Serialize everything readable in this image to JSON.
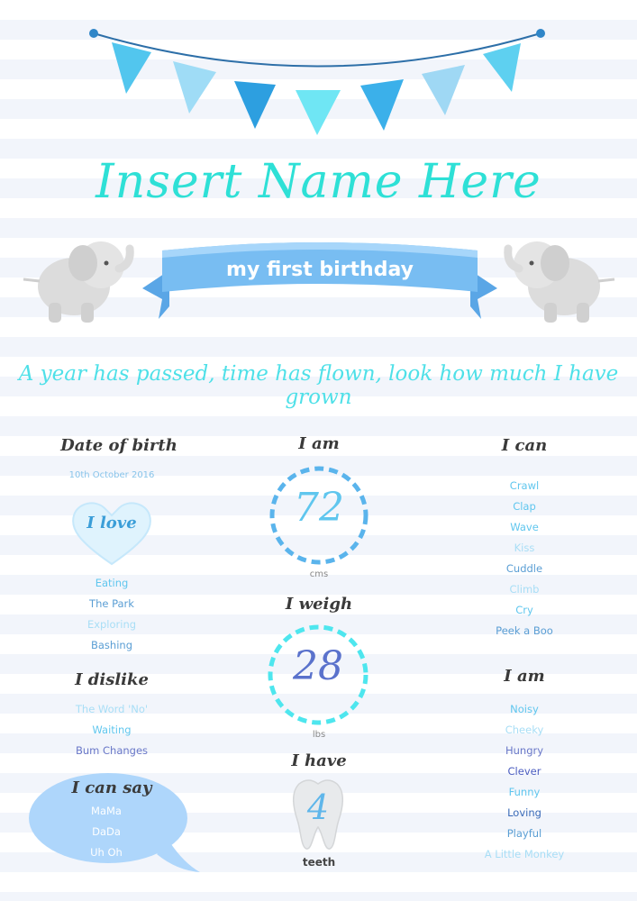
{
  "title": "Insert Name Here",
  "ribbon_text": "my first birthday",
  "tagline": "A year has passed, time has flown, look how much I have grown",
  "left": {
    "dob_heading": "Date of birth",
    "dob_value": "10th October 2016",
    "love_heading": "I love",
    "love_items": [
      "Eating",
      "The Park",
      "Exploring",
      "Bashing"
    ],
    "dislike_heading": "I dislike",
    "dislike_items": [
      "The Word 'No'",
      "Waiting",
      "Bum Changes"
    ],
    "say_heading": "I can say",
    "say_items": [
      "MaMa",
      "DaDa",
      "Uh Oh"
    ]
  },
  "middle": {
    "height_heading": "I am",
    "height_value": "72",
    "height_unit": "cms",
    "weight_heading": "I weigh",
    "weight_value": "28",
    "weight_unit": "lbs",
    "teeth_heading": "I have",
    "teeth_value": "4",
    "teeth_unit": "teeth"
  },
  "right": {
    "can_heading": "I can",
    "can_items": [
      "Crawl",
      "Clap",
      "Wave",
      "Kiss",
      "Cuddle",
      "Climb",
      "Cry",
      "Peek a Boo"
    ],
    "am_heading": "I am",
    "am_items": [
      "Noisy",
      "Cheeky",
      "Hungry",
      "Clever",
      "Funny",
      "Loving",
      "Playful",
      "A Little Monkey"
    ]
  },
  "colors": {
    "title": "#2ee0d6",
    "ribbon": "#6fb6ee",
    "dashed_ring_1": "#5ab4ec",
    "dashed_ring_2": "#4ee6ee"
  }
}
